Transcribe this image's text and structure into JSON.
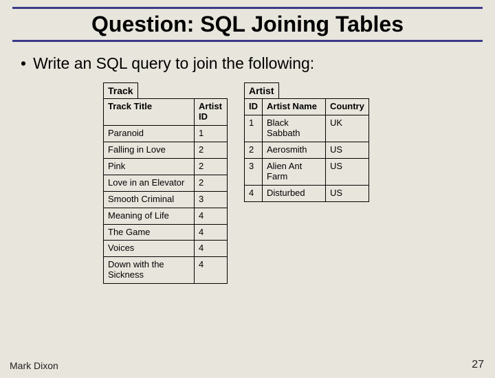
{
  "title": "Question: SQL Joining Tables",
  "bullet": "Write an SQL query to join the following:",
  "track": {
    "caption": "Track",
    "headers": [
      "Track Title",
      "Artist ID"
    ],
    "rows": [
      [
        "Paranoid",
        "1"
      ],
      [
        "Falling in Love",
        "2"
      ],
      [
        "Pink",
        "2"
      ],
      [
        "Love in an Elevator",
        "2"
      ],
      [
        "Smooth Criminal",
        "3"
      ],
      [
        "Meaning of Life",
        "4"
      ],
      [
        "The Game",
        "4"
      ],
      [
        "Voices",
        "4"
      ],
      [
        "Down with the Sickness",
        "4"
      ]
    ]
  },
  "artist": {
    "caption": "Artist",
    "headers": [
      "ID",
      "Artist Name",
      "Country"
    ],
    "rows": [
      [
        "1",
        "Black Sabbath",
        "UK"
      ],
      [
        "2",
        "Aerosmith",
        "US"
      ],
      [
        "3",
        "Alien Ant Farm",
        "US"
      ],
      [
        "4",
        "Disturbed",
        "US"
      ]
    ]
  },
  "footer": {
    "left": "Mark Dixon",
    "right": "27"
  }
}
